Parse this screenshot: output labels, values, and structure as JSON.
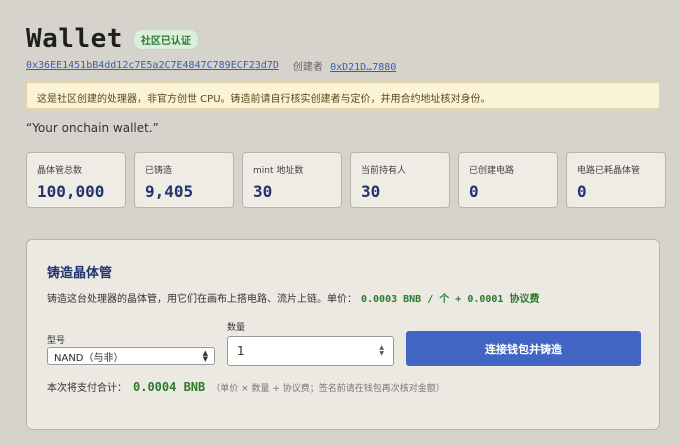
{
  "header": {
    "title": "Wallet",
    "badge": "社区已认证"
  },
  "meta": {
    "address": "0x36EE1451bB4dd12c7E5a2C7E4847C789ECF23d7D",
    "creator_label": "创建者",
    "creator_address": "0xD21D…7880"
  },
  "warning": "这是社区创建的处理器，非官方创世 CPU。铸造前请自行核实创建者与定价，并用合约地址核对身份。",
  "tagline": "“Your onchain wallet.”",
  "stats": [
    {
      "label": "晶体管总数",
      "value": "100,000"
    },
    {
      "label": "已铸造",
      "value": "9,405"
    },
    {
      "label": "mint 地址数",
      "value": "30"
    },
    {
      "label": "当前持有人",
      "value": "30"
    },
    {
      "label": "已创建电路",
      "value": "0"
    },
    {
      "label": "电路已耗晶体管",
      "value": "0"
    }
  ],
  "mint": {
    "title": "铸造晶体管",
    "desc_prefix": "铸造这台处理器的晶体管，用它们在画布上搭电路、流片上链。单价：",
    "price": "0.0003 BNB / 个 + 0.0001 协议费",
    "model_label": "型号",
    "model_value": "NAND（与非）",
    "qty_label": "数量",
    "qty_value": "1",
    "button_label": "连接钱包并铸造",
    "total_label": "本次将支付合计：",
    "total_amount": "0.0004 BNB",
    "total_hint": "（单价 × 数量 + 协议费；签名前请在钱包再次核对金额）"
  }
}
